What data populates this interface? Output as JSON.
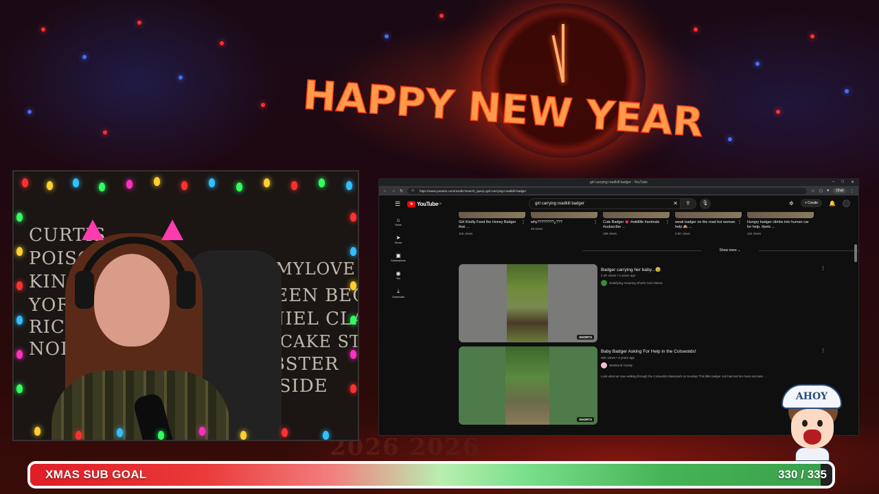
{
  "overlay": {
    "banner": "HAPPY NEW YEAR",
    "floor_year": "2026 2026"
  },
  "chalkboard": {
    "lines": [
      "CURTIS",
      "POISON",
      "KING",
      "YORK",
      "RICH",
      "NOI",
      "DR AMYLOVE JOSH",
      "QUEEN BECS",
      "DANIEL CLAIRE",
      "CUPCAKE STORM",
      "LOBSTER",
      "R CSIDE"
    ]
  },
  "browser": {
    "tab_title": "girl carrying roadkill badger - YouTube",
    "url": "https://www.youtube.com/results?search_query=girl+carrying+roadkill+badger",
    "chat_label": "Chat"
  },
  "youtube": {
    "logo_text": "YouTube",
    "logo_region": "GB",
    "search_value": "girl carrying roadkill badger",
    "create_label": "Create",
    "sidebar": [
      {
        "label": "Home",
        "icon": "home-icon",
        "glyph": "⌂"
      },
      {
        "label": "Shorts",
        "icon": "shorts-icon",
        "glyph": "➤"
      },
      {
        "label": "Subscriptions",
        "icon": "subscriptions-icon",
        "glyph": "▣"
      },
      {
        "label": "You",
        "icon": "you-icon",
        "glyph": "◉"
      },
      {
        "label": "Downloads",
        "icon": "downloads-icon",
        "glyph": "⤓"
      }
    ],
    "shorts": [
      {
        "title": "Girl Kindly Feed the Honey Badger that ....",
        "views": "11K views"
      },
      {
        "title": "why????????¿???",
        "views": "29 views"
      },
      {
        "title": "Cute Badger 💗 #wildlife #animals #subscribe ...",
        "views": "186 views"
      },
      {
        "title": "weak badger on the road but woman help 🙈 ...",
        "views": "3.5K views"
      },
      {
        "title": "Hungry badger climbs into human car for help. #pets ...",
        "views": "11K views"
      }
    ],
    "show_more": "Show more",
    "results": [
      {
        "title": "Badger carrying her baby...🥹",
        "meta": "2.2K views • 4 years ago",
        "channel": "Satisfying Amazing Shorts And Videos",
        "badge": "SHORTS",
        "desc": ""
      },
      {
        "title": "Baby Badger Asking For Help in the Cotswolds!",
        "meta": "48K views • 3 years ago",
        "channel": "Weekend Candy",
        "badge": "SHORTS",
        "desc": "Look what we saw walking through the Cotswolds Waterpark on Sunday! This little badger cub had lost her mum and was ..."
      }
    ]
  },
  "mascot": {
    "hat_text": "AHOY"
  },
  "goal": {
    "label": "XMAS SUB GOAL",
    "count": "330 / 335",
    "current": 330,
    "target": 335
  }
}
